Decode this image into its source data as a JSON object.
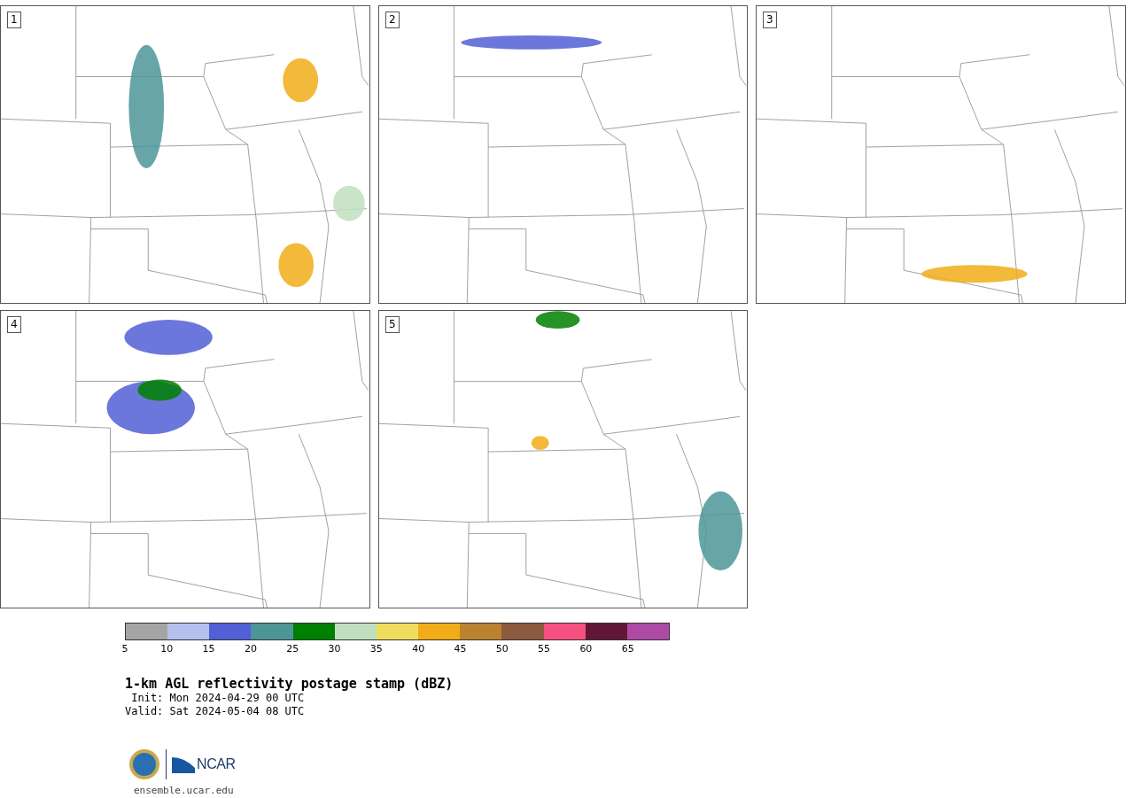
{
  "panels": [
    {
      "label": "1"
    },
    {
      "label": "2"
    },
    {
      "label": "3"
    },
    {
      "label": "4"
    },
    {
      "label": "5"
    }
  ],
  "legend": {
    "bins": [
      {
        "color": "#a5a5a5"
      },
      {
        "color": "#b5c0ee"
      },
      {
        "color": "#525fd6"
      },
      {
        "color": "#4e9598"
      },
      {
        "color": "#008000"
      },
      {
        "color": "#bfdfbf"
      },
      {
        "color": "#f0dc5c"
      },
      {
        "color": "#f0ad18"
      },
      {
        "color": "#bb8330"
      },
      {
        "color": "#8c5a3e"
      },
      {
        "color": "#f65080"
      },
      {
        "color": "#621736"
      },
      {
        "color": "#ad4aa4"
      }
    ],
    "ticks": [
      "5",
      "10",
      "15",
      "20",
      "25",
      "30",
      "35",
      "40",
      "45",
      "50",
      "55",
      "60",
      "65"
    ]
  },
  "title": "1-km AGL reflectivity postage stamp (dBZ)",
  "init": " Init: Mon 2024-04-29 00 UTC",
  "valid": "Valid: Sat 2024-05-04 08 UTC",
  "footer": {
    "logo_text": "NCAR",
    "url": "ensemble.ucar.edu"
  }
}
